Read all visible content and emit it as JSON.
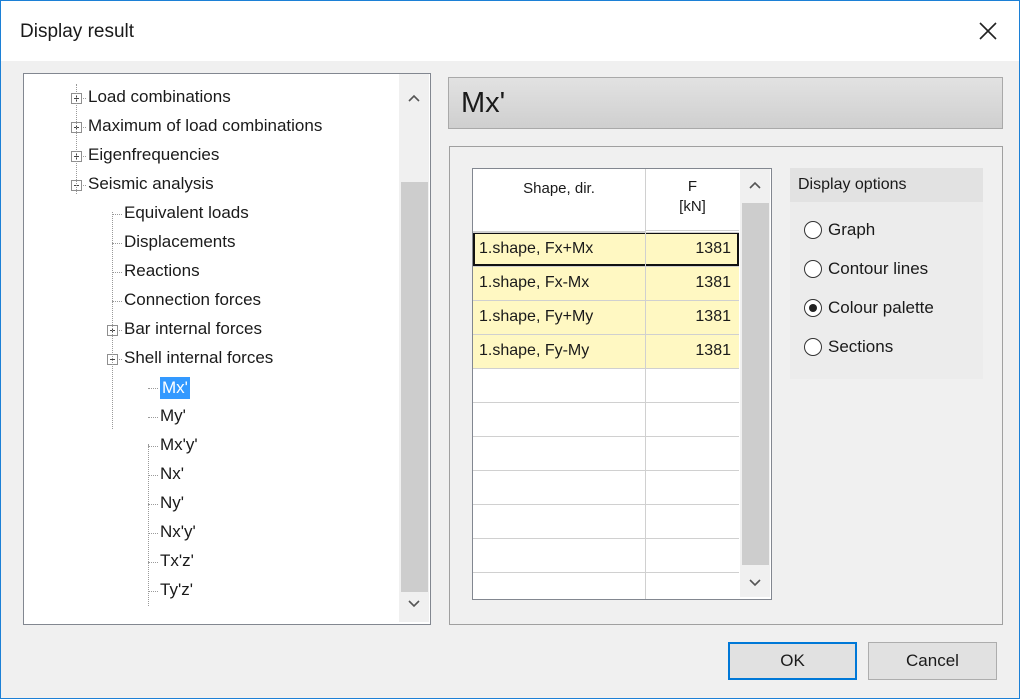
{
  "window": {
    "title": "Display result"
  },
  "tree": {
    "items": [
      {
        "label": "Load combinations",
        "expander": "plus"
      },
      {
        "label": "Maximum of load combinations",
        "expander": "plus"
      },
      {
        "label": "Eigenfrequencies",
        "expander": "plus"
      },
      {
        "label": "Seismic analysis",
        "expander": "minus"
      },
      {
        "label": "Equivalent loads",
        "expander": "none"
      },
      {
        "label": "Displacements",
        "expander": "none"
      },
      {
        "label": "Reactions",
        "expander": "none"
      },
      {
        "label": "Connection forces",
        "expander": "none"
      },
      {
        "label": "Bar internal forces",
        "expander": "plus"
      },
      {
        "label": "Shell internal forces",
        "expander": "minus"
      },
      {
        "label": "Mx'",
        "expander": "none",
        "selected": true
      },
      {
        "label": "My'",
        "expander": "none"
      },
      {
        "label": "Mx'y'",
        "expander": "none"
      },
      {
        "label": "Nx'",
        "expander": "none"
      },
      {
        "label": "Ny'",
        "expander": "none"
      },
      {
        "label": "Nx'y'",
        "expander": "none"
      },
      {
        "label": "Tx'z'",
        "expander": "none"
      },
      {
        "label": "Ty'z'",
        "expander": "none"
      }
    ]
  },
  "result_header": {
    "title": "Mx'"
  },
  "table": {
    "columns": [
      {
        "label": "Shape, dir."
      },
      {
        "label": "F",
        "unit": "[kN]"
      }
    ],
    "rows": [
      {
        "shape": "1.shape, Fx+Mx",
        "f": "1381"
      },
      {
        "shape": "1.shape, Fx-Mx",
        "f": "1381"
      },
      {
        "shape": "1.shape, Fy+My",
        "f": "1381"
      },
      {
        "shape": "1.shape, Fy-My",
        "f": "1381"
      }
    ]
  },
  "display_options": {
    "title": "Display options",
    "options": [
      "Graph",
      "Contour lines",
      "Colour palette",
      "Sections"
    ],
    "selected": "Colour palette"
  },
  "buttons": {
    "ok": "OK",
    "cancel": "Cancel"
  },
  "colors": {
    "row_fill": "#fff8c2",
    "selection": "#3399ff",
    "accent": "#0078d7"
  }
}
